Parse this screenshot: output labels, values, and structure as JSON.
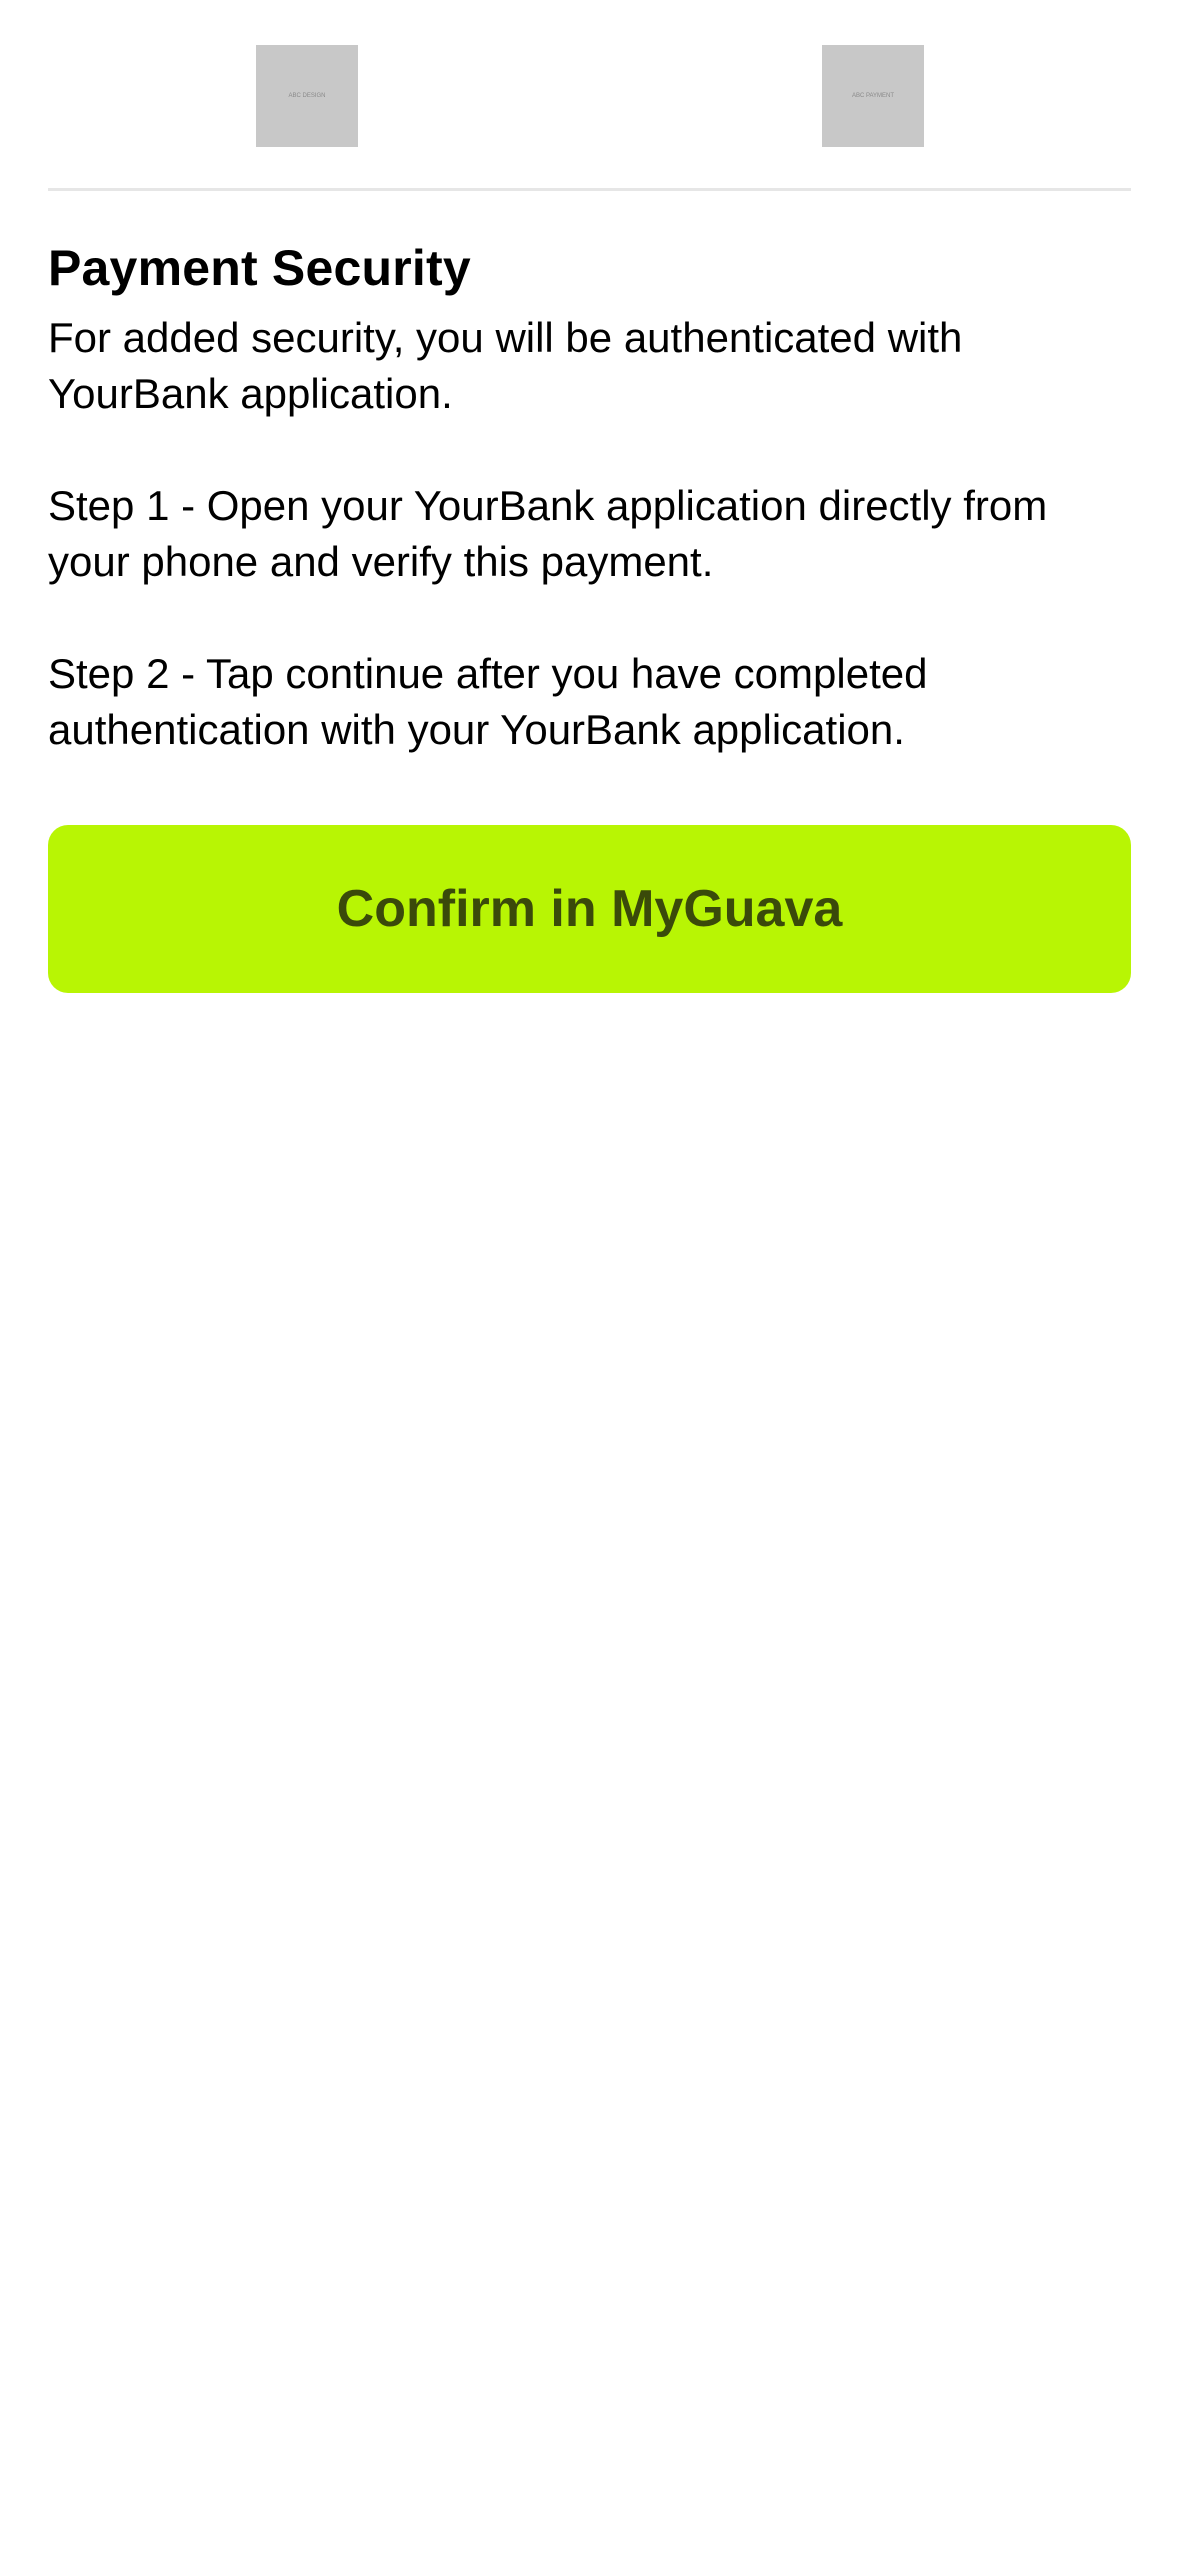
{
  "header": {
    "logo_left_text": "ABC DESIGN",
    "logo_right_text": "ABC PAYMENT"
  },
  "main": {
    "title": "Payment Security",
    "intro": "For added security, you will be authenticated with YourBank application.",
    "step1": "Step 1 - Open your YourBank application directly from your phone and verify this payment.",
    "step2": "Step 2 - Tap continue after you have completed authentication with your YourBank application."
  },
  "actions": {
    "confirm_label": "Confirm in MyGuava"
  },
  "colors": {
    "accent": "#b8f504",
    "button_text": "#3a4a0a",
    "placeholder_logo": "#c8c8c8"
  }
}
